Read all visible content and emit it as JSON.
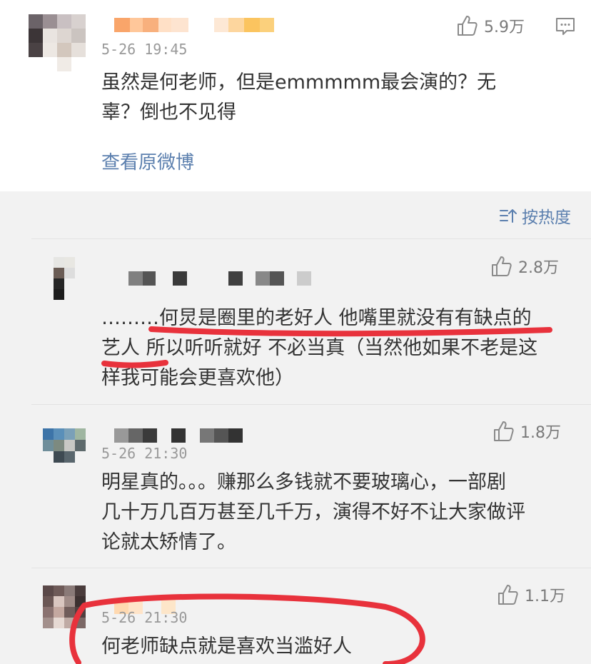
{
  "post": {
    "likes": "5.9万",
    "time": "5-26 19:45",
    "text_line1": "虽然是何老师，但是emmmmm最会演的？无",
    "text_line2": "辜？倒也不见得",
    "view_original": "查看原微博"
  },
  "sort_label": "按热度",
  "comments": [
    {
      "likes": "2.8万",
      "lines": [
        "………何炅是圈里的老好人 他嘴里就没有有缺点的",
        "艺人 所以听听就好 不必当真（当然他如果不老是这",
        "样我可能会更喜欢他）"
      ]
    },
    {
      "likes": "1.8万",
      "time": "5-26 21:30",
      "lines": [
        "明星真的。。。赚那么多钱就不要玻璃心，一部剧",
        "几十万几百万甚至几千万，演得不好不让大家做评",
        "论就太矫情了。"
      ]
    },
    {
      "likes": "1.1万",
      "time": "5-26 21:30",
      "lines": [
        "何老师缺点就是喜欢当滥好人"
      ]
    }
  ],
  "colors": {
    "link": "#5b7fae",
    "annotation": "#e8323c"
  }
}
